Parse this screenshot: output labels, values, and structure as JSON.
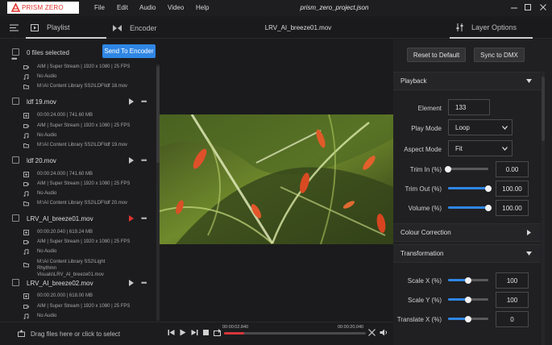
{
  "app": {
    "brand": "PRISM ZERO",
    "project_file": "prism_zero_project.json"
  },
  "menu": [
    "File",
    "Edit",
    "Audio",
    "Video",
    "Help"
  ],
  "tabs": {
    "playlist": "Playlist",
    "encoder": "Encoder",
    "layer_options": "Layer Options"
  },
  "now_playing": "LRV_AI_breeze01.mov",
  "playlist": {
    "selected_label": "0 files selected",
    "send_button": "Send To Encoder",
    "partial_item": {
      "stream": "AIM | Super Stream | 1920 x 1080 | 25 FPS",
      "audio": "No Audio",
      "path": "M:\\AI Content Library SS2\\LDF\\ldf 18.mov"
    },
    "items": [
      {
        "name": "ldf 19.mov",
        "duration": "00:00:24.000 | 741.60 MB",
        "stream": "AIM | Super Stream | 1920 x 1080 | 25 FPS",
        "audio": "No Audio",
        "path": "M:\\AI Content Library SS2\\LDF\\ldf 19.mov"
      },
      {
        "name": "ldf 20.mov",
        "duration": "00:00:24.000 | 741.60 MB",
        "stream": "AIM | Super Stream | 1920 x 1080 | 25 FPS",
        "audio": "No Audio",
        "path": "M:\\AI Content Library SS2\\LDF\\ldf 20.mov"
      },
      {
        "name": "LRV_AI_breeze01.mov",
        "duration": "00:00:20.040 | 619.24 MB",
        "stream": "AIM | Super Stream | 1920 x 1080 | 25 FPS",
        "audio": "No Audio",
        "path": "M:\\AI Content Library SS2\\Light Rhythmn Visuals\\LRV_AI_breeze01.mov"
      },
      {
        "name": "LRV_AI_breeze02.mov",
        "duration": "00:00:20.000 | 618.00 MB",
        "stream": "AIM | Super Stream | 1920 x 1080 | 25 FPS",
        "audio": "No Audio"
      }
    ],
    "drop_hint": "Drag files here or click to select"
  },
  "transport": {
    "current_time": "00:00:02.840",
    "total_time": "00:00:20.040",
    "progress": 0.14
  },
  "layer_options": {
    "reset_button": "Reset to Default",
    "sync_button": "Sync to DMX",
    "playback": {
      "header": "Playback",
      "element_label": "Element",
      "element_value": "133",
      "play_mode_label": "Play Mode",
      "play_mode_value": "Loop",
      "aspect_label": "Aspect Mode",
      "aspect_value": "Fit",
      "trim_in_label": "Trim In (%)",
      "trim_in_value": "0.00",
      "trim_in_level": 0.0,
      "trim_out_label": "Trim Out (%)",
      "trim_out_value": "100.00",
      "trim_out_level": 1.0,
      "volume_label": "Volume (%)",
      "volume_value": "100.00",
      "volume_level": 1.0
    },
    "colour_correction": {
      "header": "Colour Correction"
    },
    "transformation": {
      "header": "Transformation",
      "scale_x_label": "Scale X (%)",
      "scale_x_value": "100",
      "scale_x_level": 0.5,
      "scale_y_label": "Scale Y (%)",
      "scale_y_value": "100",
      "scale_y_level": 0.5,
      "translate_x_label": "Translate X (%)",
      "translate_x_value": "0",
      "translate_x_level": 0.5
    }
  },
  "colors": {
    "accent": "#2f86e4",
    "brand": "#e0342f",
    "active_play": "#e0342f",
    "progress": "#d8353a"
  }
}
